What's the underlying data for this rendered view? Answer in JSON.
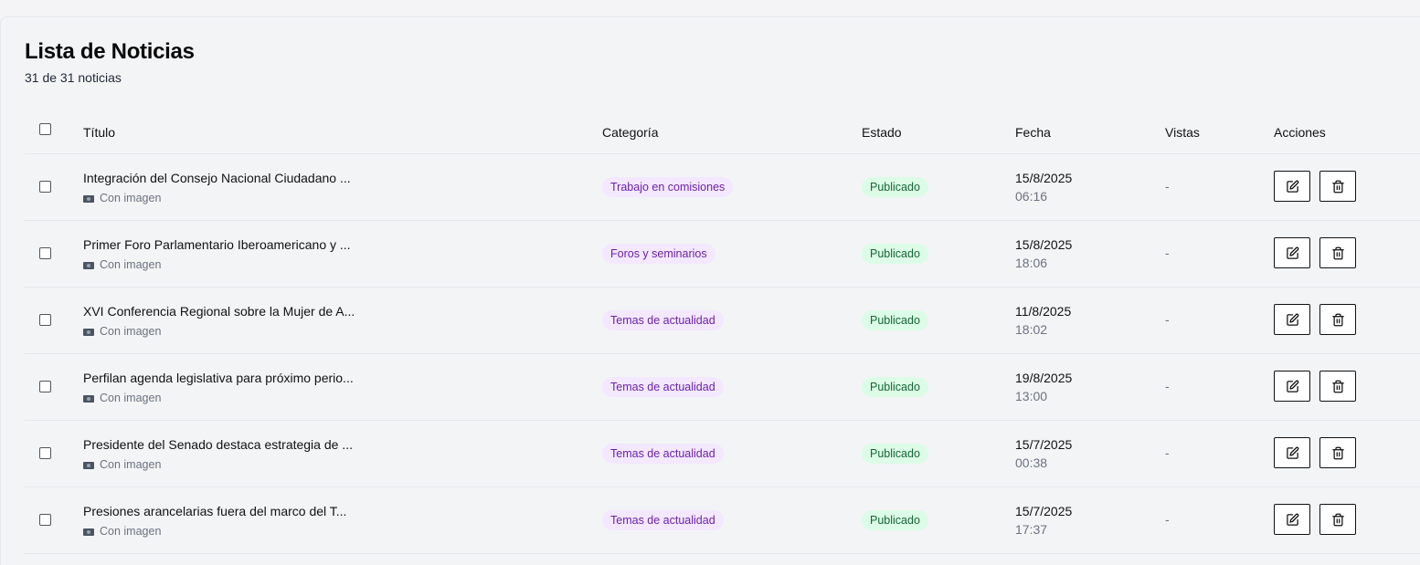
{
  "header": {
    "title": "Lista de Noticias",
    "count_text": "31 de 31 noticias"
  },
  "table": {
    "columns": {
      "title": "Título",
      "category": "Categoría",
      "status": "Estado",
      "date": "Fecha",
      "views": "Vistas",
      "actions": "Acciones"
    },
    "rows": [
      {
        "title": "Integración del Consejo Nacional Ciudadano ...",
        "image_label": "Con imagen",
        "category": "Trabajo en comisiones",
        "status": "Publicado",
        "date": "15/8/2025",
        "time": "06:16",
        "views": "-"
      },
      {
        "title": "Primer Foro Parlamentario Iberoamericano y ...",
        "image_label": "Con imagen",
        "category": "Foros y seminarios",
        "status": "Publicado",
        "date": "15/8/2025",
        "time": "18:06",
        "views": "-"
      },
      {
        "title": "XVI Conferencia Regional sobre la Mujer de A...",
        "image_label": "Con imagen",
        "category": "Temas de actualidad",
        "status": "Publicado",
        "date": "11/8/2025",
        "time": "18:02",
        "views": "-"
      },
      {
        "title": "Perfilan agenda legislativa para próximo perio...",
        "image_label": "Con imagen",
        "category": "Temas de actualidad",
        "status": "Publicado",
        "date": "19/8/2025",
        "time": "13:00",
        "views": "-"
      },
      {
        "title": "Presidente del Senado destaca estrategia de ...",
        "image_label": "Con imagen",
        "category": "Temas de actualidad",
        "status": "Publicado",
        "date": "15/7/2025",
        "time": "00:38",
        "views": "-"
      },
      {
        "title": "Presiones arancelarias fuera del marco del T...",
        "image_label": "Con imagen",
        "category": "Temas de actualidad",
        "status": "Publicado",
        "date": "15/7/2025",
        "time": "17:37",
        "views": "-"
      }
    ]
  },
  "icons": {
    "row_image": "camera-icon",
    "edit": "edit-icon",
    "delete": "trash-icon"
  },
  "colors": {
    "category_badge_bg": "#f3e8ff",
    "category_badge_text": "#6b21a8",
    "status_badge_bg": "#dcfce7",
    "status_badge_text": "#166534"
  }
}
